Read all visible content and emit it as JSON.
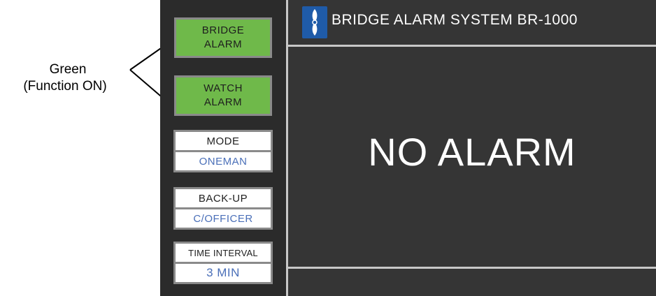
{
  "annotation": {
    "line1": "Green",
    "line2": "(Function ON)"
  },
  "left_panel": {
    "bridge_alarm": {
      "line1": "BRIDGE",
      "line2": "ALARM"
    },
    "watch_alarm": {
      "line1": "WATCH",
      "line2": "ALARM"
    },
    "mode": {
      "label": "MODE",
      "value": "ONEMAN"
    },
    "backup": {
      "label": "BACK-UP",
      "value": "C/OFFICER"
    },
    "time_interval": {
      "label": "TIME INTERVAL",
      "value": "3 MIN"
    }
  },
  "main": {
    "title": "BRIDGE ALARM SYSTEM BR-1000",
    "message": "NO ALARM"
  },
  "colors": {
    "active_green": "#6fb94a",
    "value_blue": "#4a6fb8",
    "panel_dark": "#2b2b2b",
    "screen_dark": "#353535",
    "logo_blue": "#1f5ba8"
  }
}
